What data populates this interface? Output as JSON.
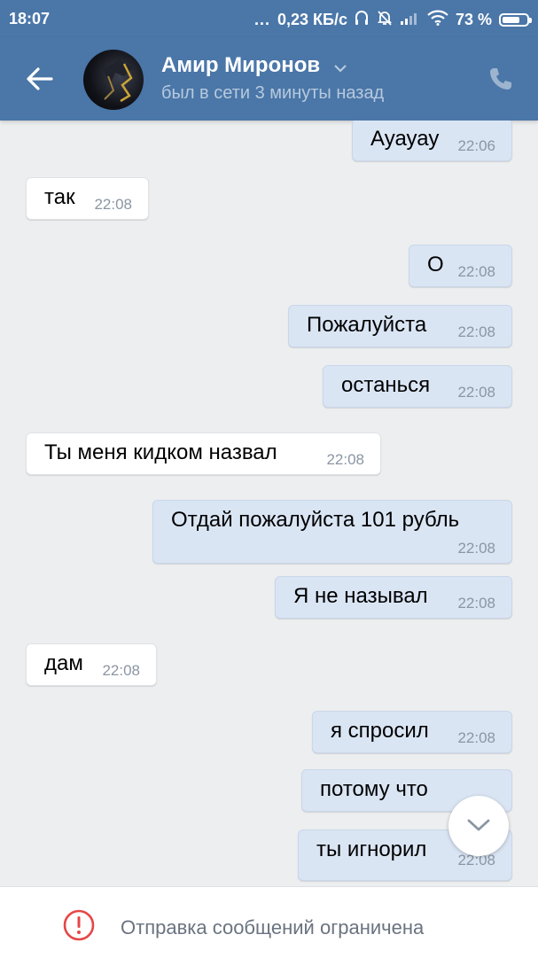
{
  "status_bar": {
    "time": "18:07",
    "dots": "...",
    "network_speed": "0,23 КБ/с",
    "battery_percent": "73 %",
    "battery_level": 0.73,
    "icons": [
      "headphones-icon",
      "mute-bell-icon",
      "signal-icon",
      "wifi-icon",
      "battery-icon"
    ]
  },
  "header": {
    "contact_name": "Амир Миронов",
    "contact_status": "был в сети 3 минуты назад",
    "icons": [
      "back-arrow-icon",
      "chevron-down-icon",
      "phone-icon"
    ]
  },
  "messages": [
    {
      "direction": "out",
      "text": "Ауауау",
      "time": "22:06"
    },
    {
      "direction": "in",
      "text": "так",
      "time": "22:08"
    },
    {
      "direction": "out",
      "text": "О",
      "time": "22:08"
    },
    {
      "direction": "out",
      "text": "Пожалуйста",
      "time": "22:08"
    },
    {
      "direction": "out",
      "text": "останься",
      "time": "22:08"
    },
    {
      "direction": "in",
      "text": "Ты меня кидком назвал",
      "time": "22:08"
    },
    {
      "direction": "out",
      "text": "Отдай пожалуйста 101 рубль",
      "time": "22:08"
    },
    {
      "direction": "out",
      "text": "Я не называл",
      "time": "22:08"
    },
    {
      "direction": "in",
      "text": "дам",
      "time": "22:08"
    },
    {
      "direction": "out",
      "text": "я спросил",
      "time": "22:08"
    },
    {
      "direction": "out",
      "text": "потому что",
      "time": ""
    },
    {
      "direction": "out",
      "text": "ты игнорил",
      "time": "22:08"
    }
  ],
  "bottom_bar": {
    "restriction_text": "Отправка сообщений ограничена",
    "icon": "alert-circle-icon"
  },
  "colors": {
    "header_bg": "#4a76a8",
    "chat_bg": "#edeef0",
    "outgoing_bubble": "#dae5f4",
    "incoming_bubble": "#ffffff",
    "alert_red": "#e64646"
  }
}
